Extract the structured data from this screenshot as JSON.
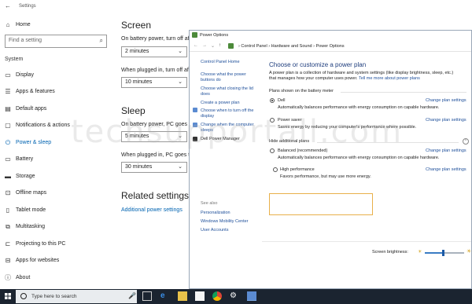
{
  "settings": {
    "title": "Settings",
    "home": "Home",
    "search_placeholder": "Find a setting",
    "category": "System",
    "nav": [
      {
        "label": "Display",
        "icon": "display-icon"
      },
      {
        "label": "Apps & features",
        "icon": "apps-icon"
      },
      {
        "label": "Default apps",
        "icon": "default-apps-icon"
      },
      {
        "label": "Notifications & actions",
        "icon": "notifications-icon"
      },
      {
        "label": "Power & sleep",
        "icon": "power-icon"
      },
      {
        "label": "Battery",
        "icon": "battery-icon"
      },
      {
        "label": "Storage",
        "icon": "storage-icon"
      },
      {
        "label": "Offline maps",
        "icon": "maps-icon"
      },
      {
        "label": "Tablet mode",
        "icon": "tablet-icon"
      },
      {
        "label": "Multitasking",
        "icon": "multitasking-icon"
      },
      {
        "label": "Projecting to this PC",
        "icon": "projecting-icon"
      },
      {
        "label": "Apps for websites",
        "icon": "websites-icon"
      },
      {
        "label": "About",
        "icon": "about-icon"
      }
    ],
    "active_item": "Power & sleep",
    "screen": {
      "heading": "Screen",
      "battery_label": "On battery power, turn off aft",
      "battery_value": "2 minutes",
      "plugged_label": "When plugged in, turn off afte",
      "plugged_value": "10 minutes"
    },
    "sleep": {
      "heading": "Sleep",
      "battery_label": "On battery power, PC goes to",
      "battery_value": "5 minutes",
      "plugged_label": "When plugged in, PC goes to",
      "plugged_value": "30 minutes"
    },
    "related": {
      "heading": "Related settings",
      "link": "Additional power settings"
    }
  },
  "power": {
    "title": "Power Options",
    "breadcrumb": [
      "Control Panel",
      "Hardware and Sound",
      "Power Options"
    ],
    "left": {
      "home": "Control Panel Home",
      "links": [
        "Choose what the power buttons do",
        "Choose what closing the lid does",
        "Create a power plan",
        "Choose when to turn off the display",
        "Change when the computer sleeps",
        "Dell Power Manager"
      ],
      "see_also": "See also",
      "see_also_links": [
        "Personalization",
        "Windows Mobility Center",
        "User Accounts"
      ]
    },
    "main": {
      "heading": "Choose or customize a power plan",
      "desc": "A power plan is a collection of hardware and system settings (like display brightness, sleep, etc.) that manages how your computer uses power.",
      "desc_link": "Tell me more about power plans",
      "group1": "Plans shown on the battery meter",
      "group2": "Hide additional plans",
      "plans": [
        {
          "name": "Dell",
          "desc": "Automatically balances performance with energy consumption on capable hardware.",
          "selected": true
        },
        {
          "name": "Power saver",
          "desc": "Saves energy by reducing your computer's performance where possible.",
          "selected": false
        },
        {
          "name": "Balanced (recommended)",
          "desc": "Automatically balances performance with energy consumption on capable hardware.",
          "selected": false
        },
        {
          "name": "High performance",
          "desc": "Favors performance, but may use more energy.",
          "selected": false
        }
      ],
      "change_link": "Change plan settings",
      "brightness_label": "Screen brightness:",
      "brightness_level": 0.45
    }
  },
  "watermark": "techsupportall.com",
  "taskbar": {
    "search_text": "Type here to search",
    "apps": [
      "task-view-icon",
      "edge-icon",
      "file-explorer-icon",
      "store-icon",
      "chrome-icon",
      "settings-icon",
      "control-panel-icon"
    ]
  }
}
